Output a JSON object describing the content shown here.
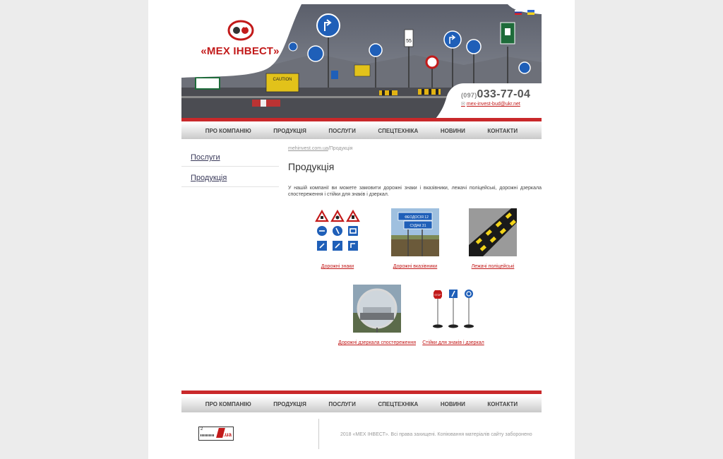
{
  "header": {
    "logo_text": "«МЕХ ІНВЕСТ»",
    "phone_code": "(097)",
    "phone": "033-77-04",
    "email": "mex-invest-bud@ukr.net",
    "sign_caution": "CAUTION",
    "sign_speed": "55"
  },
  "languages": [
    "ru",
    "ua"
  ],
  "menu": [
    "ПРО КОМПАНІЮ",
    "ПРОДУКЦІЯ",
    "ПОСЛУГИ",
    "СПЕЦТЕХНІКА",
    "НОВИНИ",
    "КОНТАКТИ"
  ],
  "sidebar": [
    "Послуги",
    "Продукція"
  ],
  "breadcrumb": {
    "home": "mehinvest.com.ua",
    "separator": "/",
    "current": "Продукція"
  },
  "title": "Продукція",
  "intro": "У нашій компанії ви можете замовити дорожні знаки і вказівники, лежачі поліцейські, дорожні дзеркала спостереження і стійки для знаків і дзеркал.",
  "products": [
    {
      "label": "Дорожні знаки"
    },
    {
      "label": "Дорожні вказівники",
      "sign_line1": "ФЕОДОСІЯ 12",
      "sign_line2": "СУДАК 31"
    },
    {
      "label": "Лежачі поліцейські"
    },
    {
      "label": "Дорожні дзеркала спостереження"
    },
    {
      "label": "Стійки для знаків і дзеркал",
      "stop": "STOP"
    }
  ],
  "footer": {
    "counter_top": "2",
    "counter_ua": ".ua",
    "copyright": "2018 «МЕХ ІНВЕСТ». Всі права захищені. Копіювання матеріалів сайту заборонено"
  },
  "colors": {
    "brand_red": "#c21a1a",
    "menu_bar": "#dcdcdc",
    "sign_blue": "#1f5fb8"
  }
}
